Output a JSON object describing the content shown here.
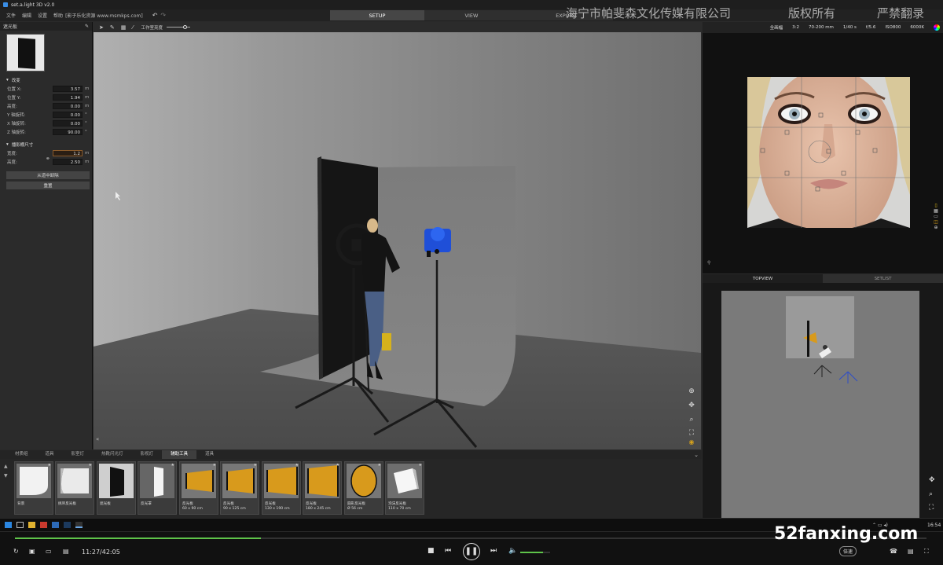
{
  "window": {
    "title": "set.a.light 3D v2.0"
  },
  "menu": {
    "items": [
      "文件",
      "编辑",
      "设置",
      "帮助"
    ],
    "note": "[影子乐化资源 www.msmkps.com]"
  },
  "modes": {
    "setup": "SETUP",
    "view": "VIEW",
    "export": "EXPORT"
  },
  "watermark": {
    "company": "海宁市帕斐森文化传媒有限公司",
    "rights": "版权所有",
    "ban": "严禁翻录"
  },
  "left_panel": {
    "title": "遮光板",
    "section_change": "改变",
    "pos_x_label": "位置 X:",
    "pos_x": "3.57",
    "pos_x_unit": "m",
    "pos_y_label": "位置 Y:",
    "pos_y": "1.94",
    "pos_y_unit": "m",
    "height_label": "高度:",
    "height": "0.00",
    "height_unit": "m",
    "rot_y_label": "Y 轴旋转:",
    "rot_y": "0.00",
    "rot_y_unit": "°",
    "rot_x_label": "X 轴旋转:",
    "rot_x": "0.00",
    "rot_x_unit": "°",
    "rot_z_label": "Z 轴旋转:",
    "rot_z": "90.00",
    "rot_z_unit": "°",
    "section_size": "播影棚尺寸",
    "width_label": "宽度:",
    "width": "1.2",
    "width_unit": "m",
    "h2_label": "高度:",
    "h2": "2.50",
    "h2_unit": "m",
    "remove_button": "从道中卸除",
    "reset_button": "重置"
  },
  "toolbar": {
    "label": "工作室亮度",
    "brightness": 0.85
  },
  "camera": {
    "format": "全画幅",
    "ratio": "3:2",
    "lens": "70-200 mm",
    "shutter": "1/40 s",
    "aperture": "f/5.6",
    "iso": "ISO800",
    "kelvin": "6000K"
  },
  "right_tabs": {
    "topview": "TOPVIEW",
    "setlist": "SETLIST"
  },
  "library": {
    "tabs": [
      "材质组",
      "道具",
      "影室灯",
      "热靴闪光灯",
      "影视灯",
      "辅助工具",
      "道具"
    ],
    "active_tab": 5,
    "items": [
      {
        "l1": "背景",
        "l2": ""
      },
      {
        "l1": "挑吊反光板",
        "l2": ""
      },
      {
        "l1": "遮光板",
        "l2": ""
      },
      {
        "l1": "反光罩",
        "l2": ""
      },
      {
        "l1": "反光板",
        "l2": "60 x 90 cm"
      },
      {
        "l1": "反光板",
        "l2": "90 x 125 cm"
      },
      {
        "l1": "反光板",
        "l2": "130 x 190 cm"
      },
      {
        "l1": "反光板",
        "l2": "180 x 245 cm"
      },
      {
        "l1": "圆形反光板",
        "l2": "Ø 56 cm"
      },
      {
        "l1": "泡沫反光板",
        "l2": "110 x 70 cm"
      }
    ]
  },
  "taskbar": {
    "time": "16:54"
  },
  "player": {
    "time": "11:27/42:05",
    "progress_fraction": 0.27,
    "quality": "倍速",
    "volume_fraction": 0.75
  },
  "site": {
    "url": "52fanxing.com"
  },
  "colors": {
    "accent_green": "#5fc44a",
    "light_blue": "#1f4fd8",
    "reflector_gold": "#d89a1c"
  }
}
